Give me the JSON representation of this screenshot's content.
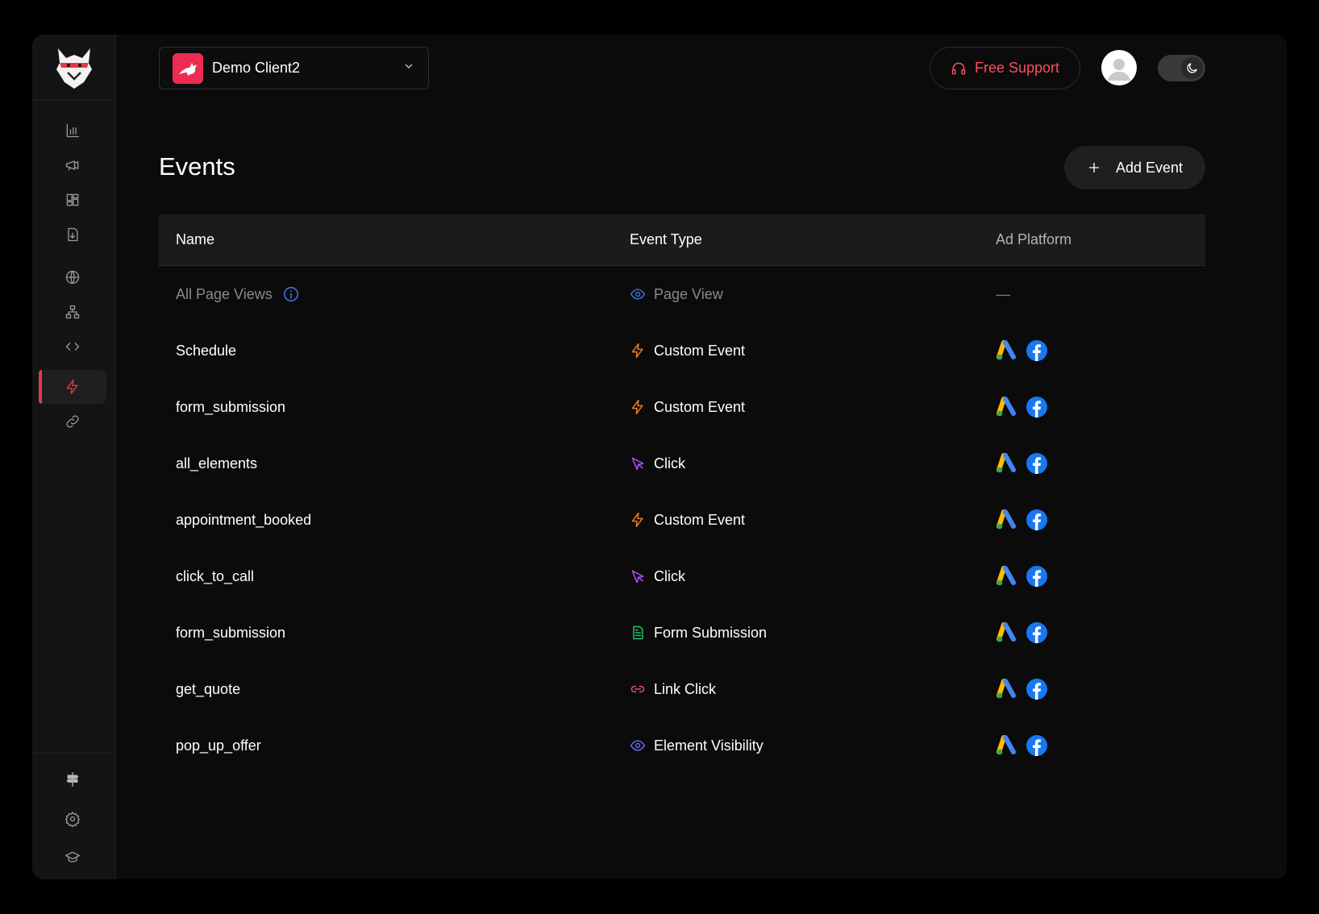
{
  "client": {
    "name": "Demo Client2"
  },
  "header": {
    "support_label": "Free Support"
  },
  "page": {
    "title": "Events",
    "add_label": "Add Event"
  },
  "table": {
    "headers": [
      "Name",
      "Event Type",
      "Ad Platform"
    ],
    "rows": [
      {
        "name": "All Page Views",
        "type": "Page View",
        "type_icon": "eye-icon",
        "type_color": "#3b6fd6",
        "platforms": "—"
      },
      {
        "name": "Schedule",
        "type": "Custom Event",
        "type_icon": "lightning-icon",
        "type_color": "#f27a1a",
        "platforms": [
          "google-ads",
          "facebook"
        ]
      },
      {
        "name": "form_submission",
        "type": "Custom Event",
        "type_icon": "lightning-icon",
        "type_color": "#f27a1a",
        "platforms": [
          "google-ads",
          "facebook"
        ]
      },
      {
        "name": "all_elements",
        "type": "Click",
        "type_icon": "cursor-icon",
        "type_color": "#a855f7",
        "platforms": [
          "google-ads",
          "facebook"
        ]
      },
      {
        "name": "appointment_booked",
        "type": "Custom Event",
        "type_icon": "lightning-icon",
        "type_color": "#f27a1a",
        "platforms": [
          "google-ads",
          "facebook"
        ]
      },
      {
        "name": "click_to_call",
        "type": "Click",
        "type_icon": "cursor-icon",
        "type_color": "#a855f7",
        "platforms": [
          "google-ads",
          "facebook"
        ]
      },
      {
        "name": "form_submission",
        "type": "Form Submission",
        "type_icon": "document-icon",
        "type_color": "#22c55e",
        "platforms": [
          "google-ads",
          "facebook"
        ]
      },
      {
        "name": "get_quote",
        "type": "Link Click",
        "type_icon": "link-icon",
        "type_color": "#ec4899",
        "platforms": [
          "google-ads",
          "facebook"
        ]
      },
      {
        "name": "pop_up_offer",
        "type": "Element Visibility",
        "type_icon": "eye-icon",
        "type_color": "#6366f1",
        "platforms": [
          "google-ads",
          "facebook"
        ]
      }
    ]
  },
  "colors": {
    "accent": "#e53945",
    "support": "#ff4d5a",
    "client_logo": "#ee2b52"
  }
}
